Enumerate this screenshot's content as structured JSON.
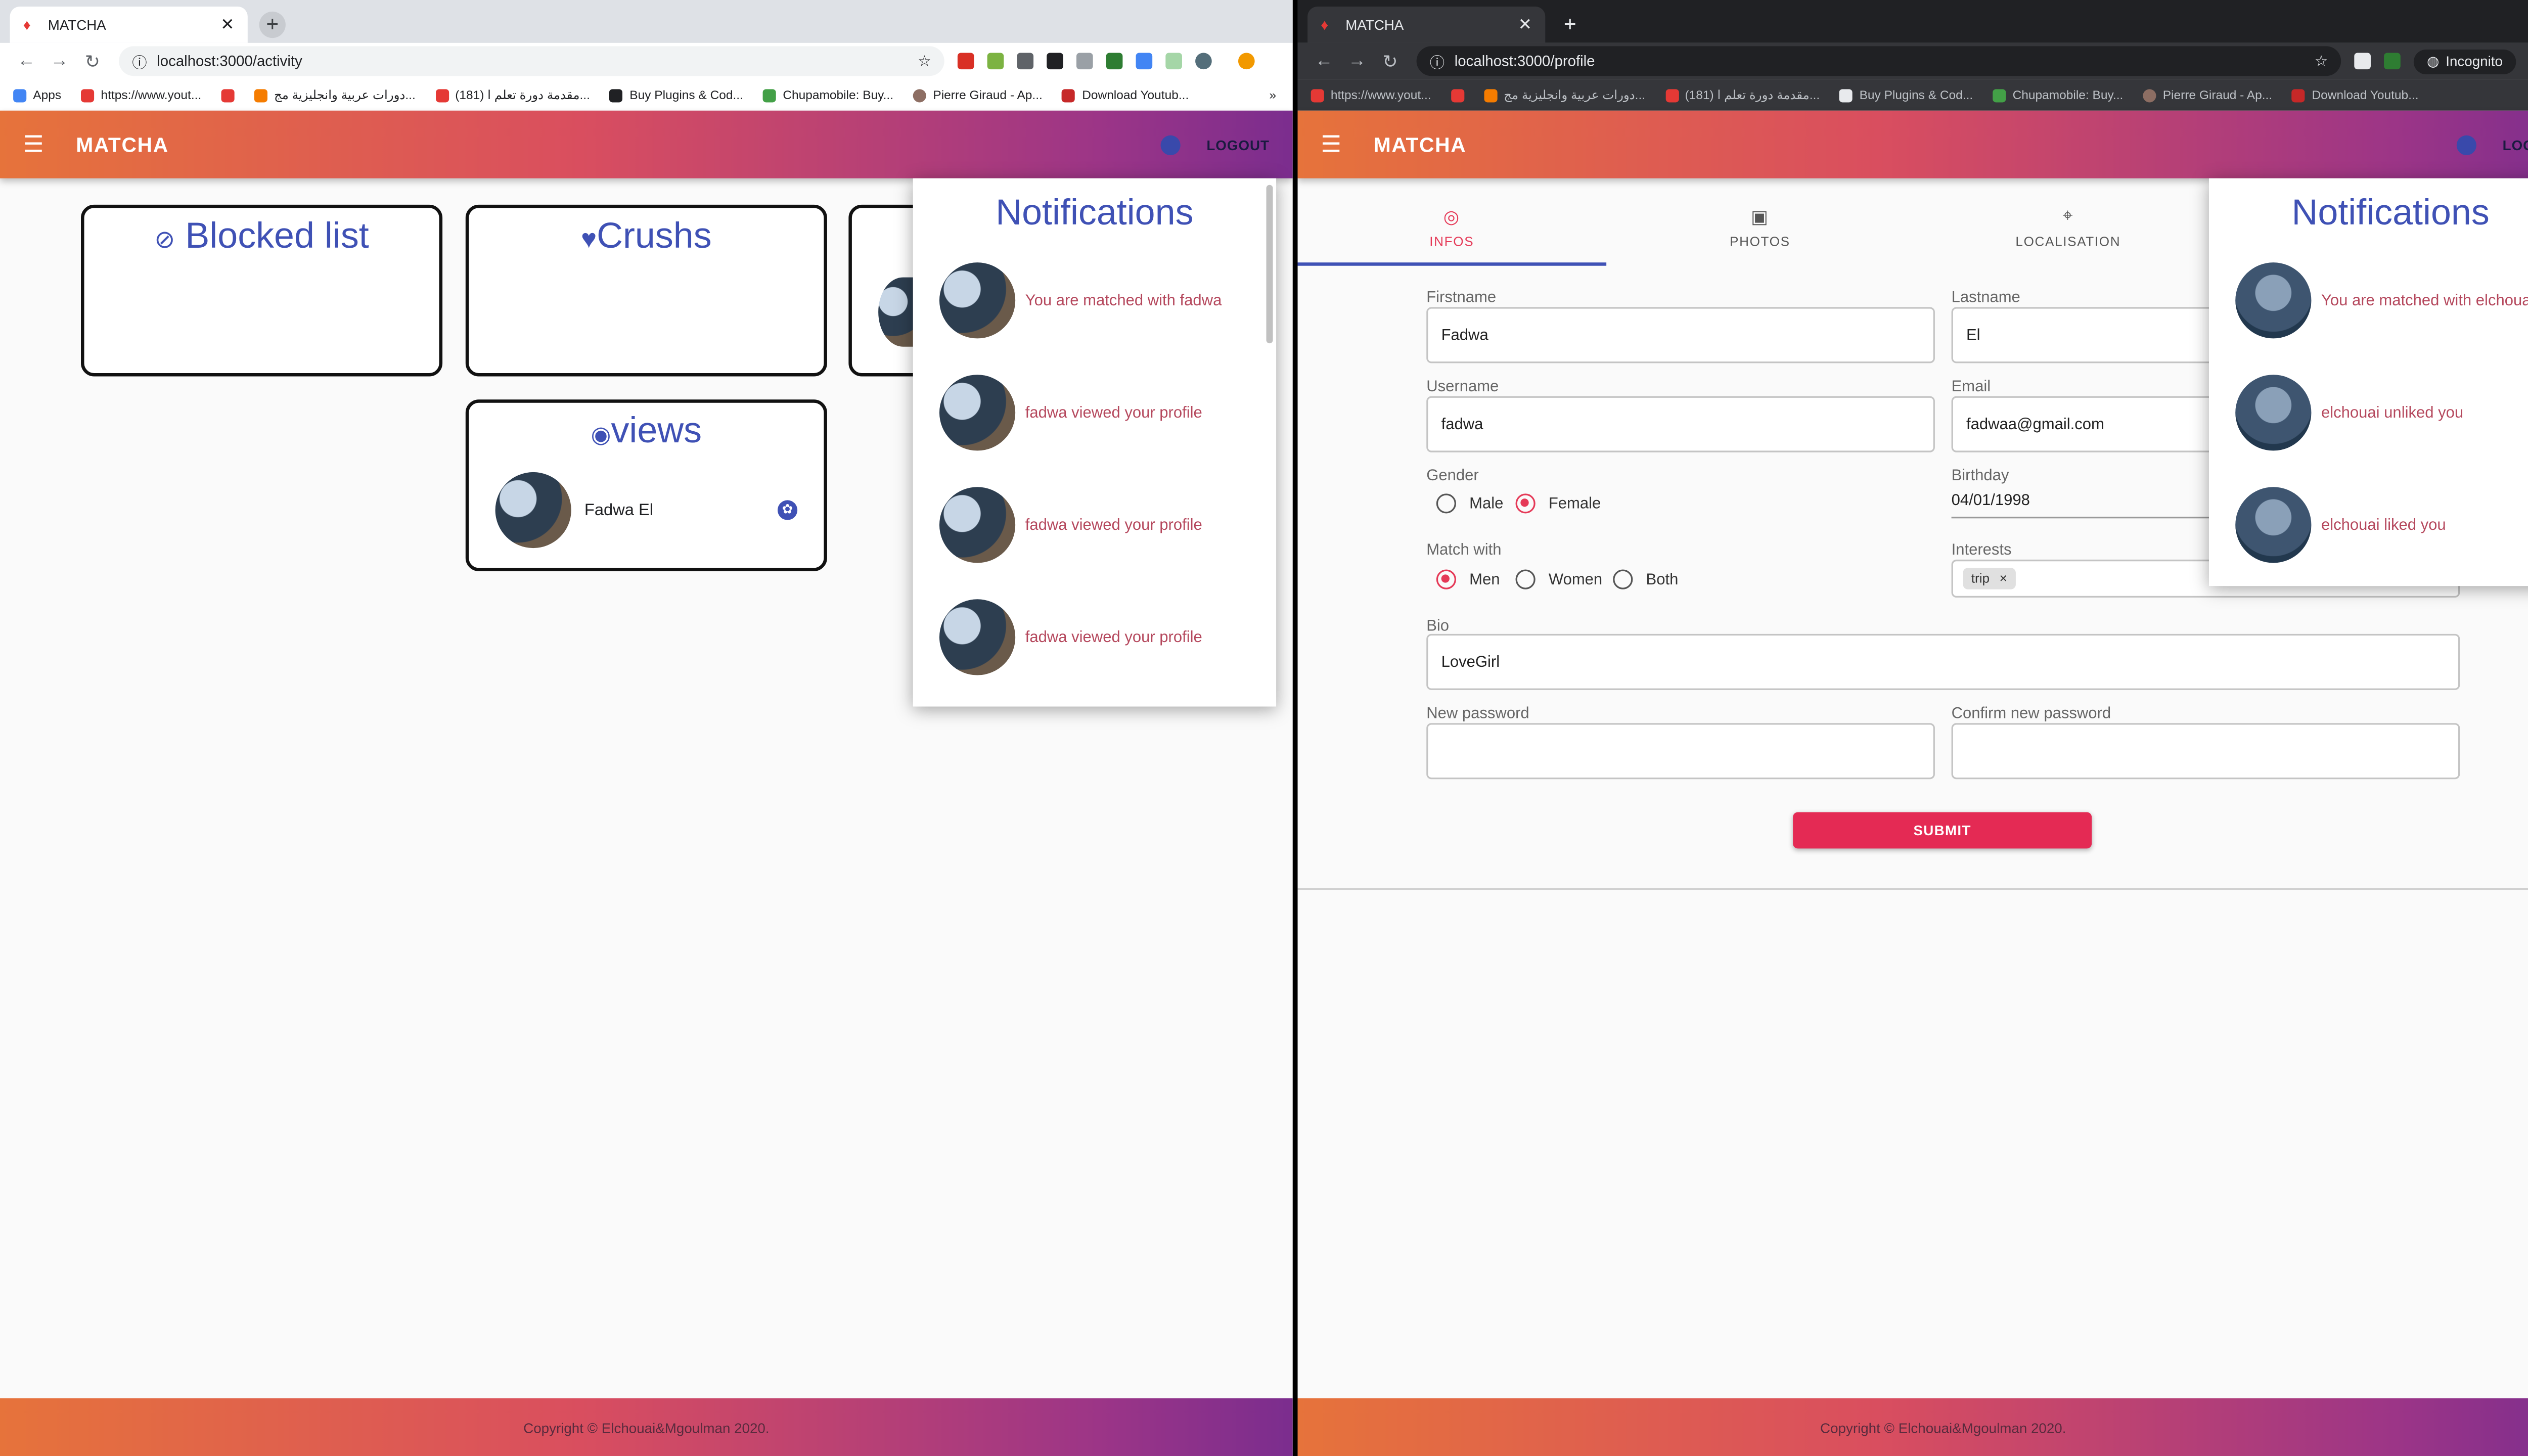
{
  "left": {
    "tab_title": "MATCHA",
    "url": "localhost:3000/activity",
    "bookmarks": [
      "Apps",
      "https://www.yout...",
      "دورات عربية وانجليزية مج...",
      "(181) مقدمة دورة تعلم ا...",
      "Buy Plugins & Cod...",
      "Chupamobile: Buy...",
      "Pierre Giraud - Ap...",
      "Download Youtub..."
    ],
    "brand": "MATCHA",
    "logout": "LOGOUT",
    "cards": {
      "blocked": "Blocked list",
      "crushes": "Crushs",
      "views": "views"
    },
    "views_item": "Fadwa El",
    "notifications": {
      "title": "Notifications",
      "items": [
        "You are matched with fadwa",
        "fadwa viewed your profile",
        "fadwa viewed your profile",
        "fadwa viewed your profile"
      ]
    },
    "footer": "Copyright © Elchouai&Mgoulman 2020."
  },
  "right": {
    "tab_title": "MATCHA",
    "url": "localhost:3000/profile",
    "incognito": "Incognito",
    "bookmarks": [
      "https://www.yout...",
      "دورات عربية وانجليزية مج...",
      "(181) مقدمة دورة تعلم ا...",
      "Buy Plugins & Cod...",
      "Chupamobile: Buy...",
      "Pierre Giraud - Ap...",
      "Download Youtub..."
    ],
    "brand": "MATCHA",
    "logout": "LOGOUT",
    "tabs": [
      "INFOS",
      "PHOTOS",
      "LOCALISATION"
    ],
    "form": {
      "firstname_label": "Firstname",
      "firstname": "Fadwa",
      "lastname_label": "Lastname",
      "lastname": "El",
      "username_label": "Username",
      "username": "fadwa",
      "email_label": "Email",
      "email": "fadwaa@gmail.com",
      "gender_label": "Gender",
      "gender_male": "Male",
      "gender_female": "Female",
      "birthday_label": "Birthday",
      "birthday": "04/01/1998",
      "match_label": "Match with",
      "match_men": "Men",
      "match_women": "Women",
      "match_both": "Both",
      "interests_label": "Interests",
      "interest_chip": "trip",
      "bio_label": "Bio",
      "bio": "LoveGirl",
      "newpass_label": "New password",
      "confirmpass_label": "Confirm new password",
      "submit": "SUBMIT"
    },
    "notifications": {
      "title": "Notifications",
      "items": [
        "You are matched with elchouai",
        "elchouai unliked you",
        "elchouai liked you"
      ]
    },
    "footer": "Copyright © Elchouai&Mgoulman 2020."
  }
}
